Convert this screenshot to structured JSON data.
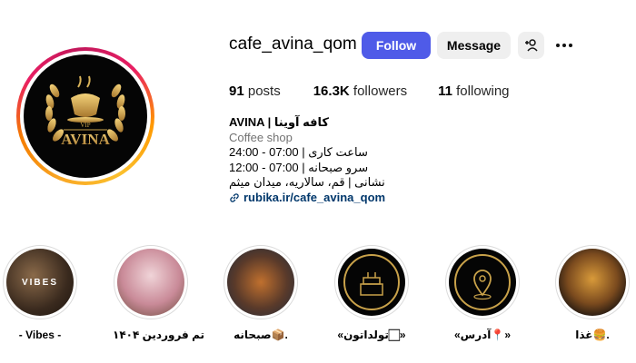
{
  "profile": {
    "username": "cafe_avina_qom",
    "avatar_logo_text": "AVINA",
    "avatar_logo_small": "VIP"
  },
  "actions": {
    "follow_label": "Follow",
    "message_label": "Message",
    "add_user_icon": "person-plus-icon",
    "more_icon": "ellipsis-icon"
  },
  "stats": {
    "posts_count": "91",
    "posts_label": "posts",
    "followers_count": "16.3K",
    "followers_label": "followers",
    "following_count": "11",
    "following_label": "following"
  },
  "bio": {
    "name": "AVINA | کافه آوینا",
    "category": "Coffee shop",
    "line1": "ساعت کاری | 07:00 - 24:00",
    "line2": "سرو صبحانه | 07:00 - 12:00",
    "line3": "نشانی | قم، سالاریه، میدان میثم",
    "link": "rubika.ir/cafe_avina_qom"
  },
  "highlights": [
    {
      "label": "- Vibes -",
      "overlay": "VIBES"
    },
    {
      "label": "تم فروردین ۱۴۰۴",
      "overlay": ""
    },
    {
      "label": "صبحانه📦.",
      "overlay": ""
    },
    {
      "label": "«تولداتون🏻»",
      "overlay": ""
    },
    {
      "label": "«آدرس📍»",
      "overlay": ""
    },
    {
      "label": "غذا🍔.",
      "overlay": ""
    }
  ],
  "colors": {
    "follow_button": "#4f5be8",
    "link": "#00376b",
    "gold": "#c9a24a"
  }
}
